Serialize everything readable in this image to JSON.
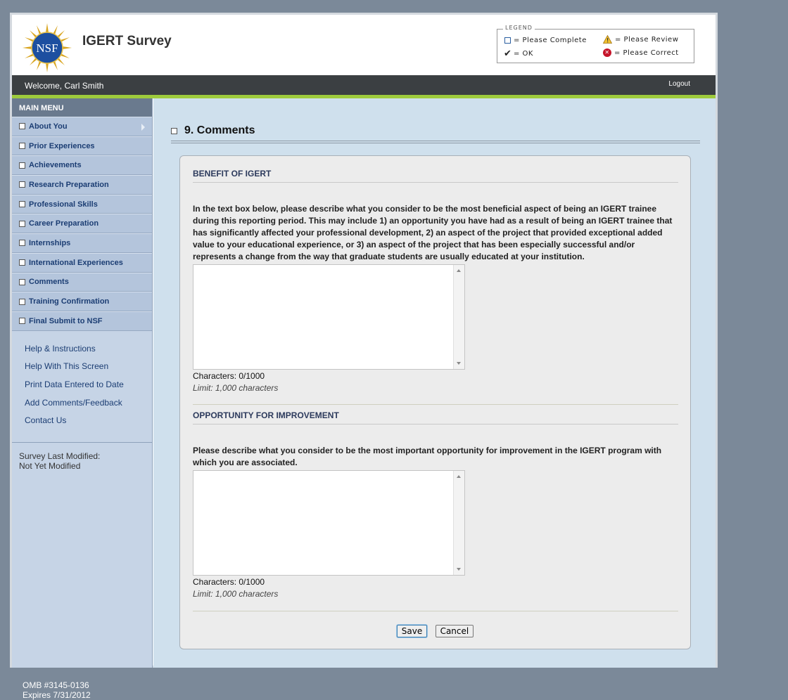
{
  "header": {
    "logo_text": "NSF",
    "app_title": "IGERT Survey"
  },
  "legend": {
    "title": "LEGEND",
    "items": [
      {
        "icon": "checkbox-empty-icon",
        "label": "= Please Complete"
      },
      {
        "icon": "warning-icon",
        "label": "= Please Review"
      },
      {
        "icon": "checkmark-icon",
        "label": "= OK"
      },
      {
        "icon": "error-icon",
        "label": "= Please Correct"
      }
    ]
  },
  "topbar": {
    "welcome": "Welcome, Carl Smith",
    "logout": "Logout"
  },
  "sidebar": {
    "menu_title": "MAIN MENU",
    "items": [
      {
        "label": "About You"
      },
      {
        "label": "Prior Experiences"
      },
      {
        "label": "Achievements"
      },
      {
        "label": "Research Preparation"
      },
      {
        "label": "Professional Skills"
      },
      {
        "label": "Career Preparation"
      },
      {
        "label": "Internships"
      },
      {
        "label": "International Experiences"
      },
      {
        "label": "Comments"
      },
      {
        "label": "Training Confirmation"
      },
      {
        "label": "Final Submit to NSF"
      }
    ],
    "links": [
      {
        "label": "Help & Instructions"
      },
      {
        "label": "Help With This Screen"
      },
      {
        "label": "Print Data Entered to Date"
      },
      {
        "label": "Add Comments/Feedback"
      },
      {
        "label": "Contact Us"
      }
    ],
    "last_modified_label": "Survey Last Modified:",
    "last_modified_value": "Not Yet Modified"
  },
  "main": {
    "section_title": "9. Comments",
    "benefit": {
      "heading": "BENEFIT OF IGERT",
      "prompt": "In the text box below, please describe what you consider to be the most beneficial aspect of being an IGERT trainee during this reporting period. This may include 1) an opportunity you have had as a result of being an IGERT trainee that has significantly affected your professional development, 2) an aspect of the project that provided exceptional added value to your educational experience, or 3) an aspect of the project that has been especially successful and/or represents a change from the way that graduate students are usually educated at your institution.",
      "value": "",
      "count": "Characters: 0/1000",
      "limit": "Limit: 1,000 characters"
    },
    "improvement": {
      "heading": "OPPORTUNITY FOR IMPROVEMENT",
      "prompt": "Please describe what you consider to be the most important opportunity for improvement in the IGERT program with which you are associated.",
      "value": "",
      "count": "Characters: 0/1000",
      "limit": "Limit: 1,000 characters"
    },
    "save_label": "Save",
    "cancel_label": "Cancel"
  },
  "footer": {
    "omb": "OMB #3145-0136",
    "expires": "Expires 7/31/2012"
  },
  "colors": {
    "background": "#7b8999",
    "topbar": "#3b3f42",
    "accent_green": "#9ecb3c",
    "sidebar": "#c6d4e6",
    "main_bg": "#cfe0ed",
    "link": "#1b3d73"
  }
}
